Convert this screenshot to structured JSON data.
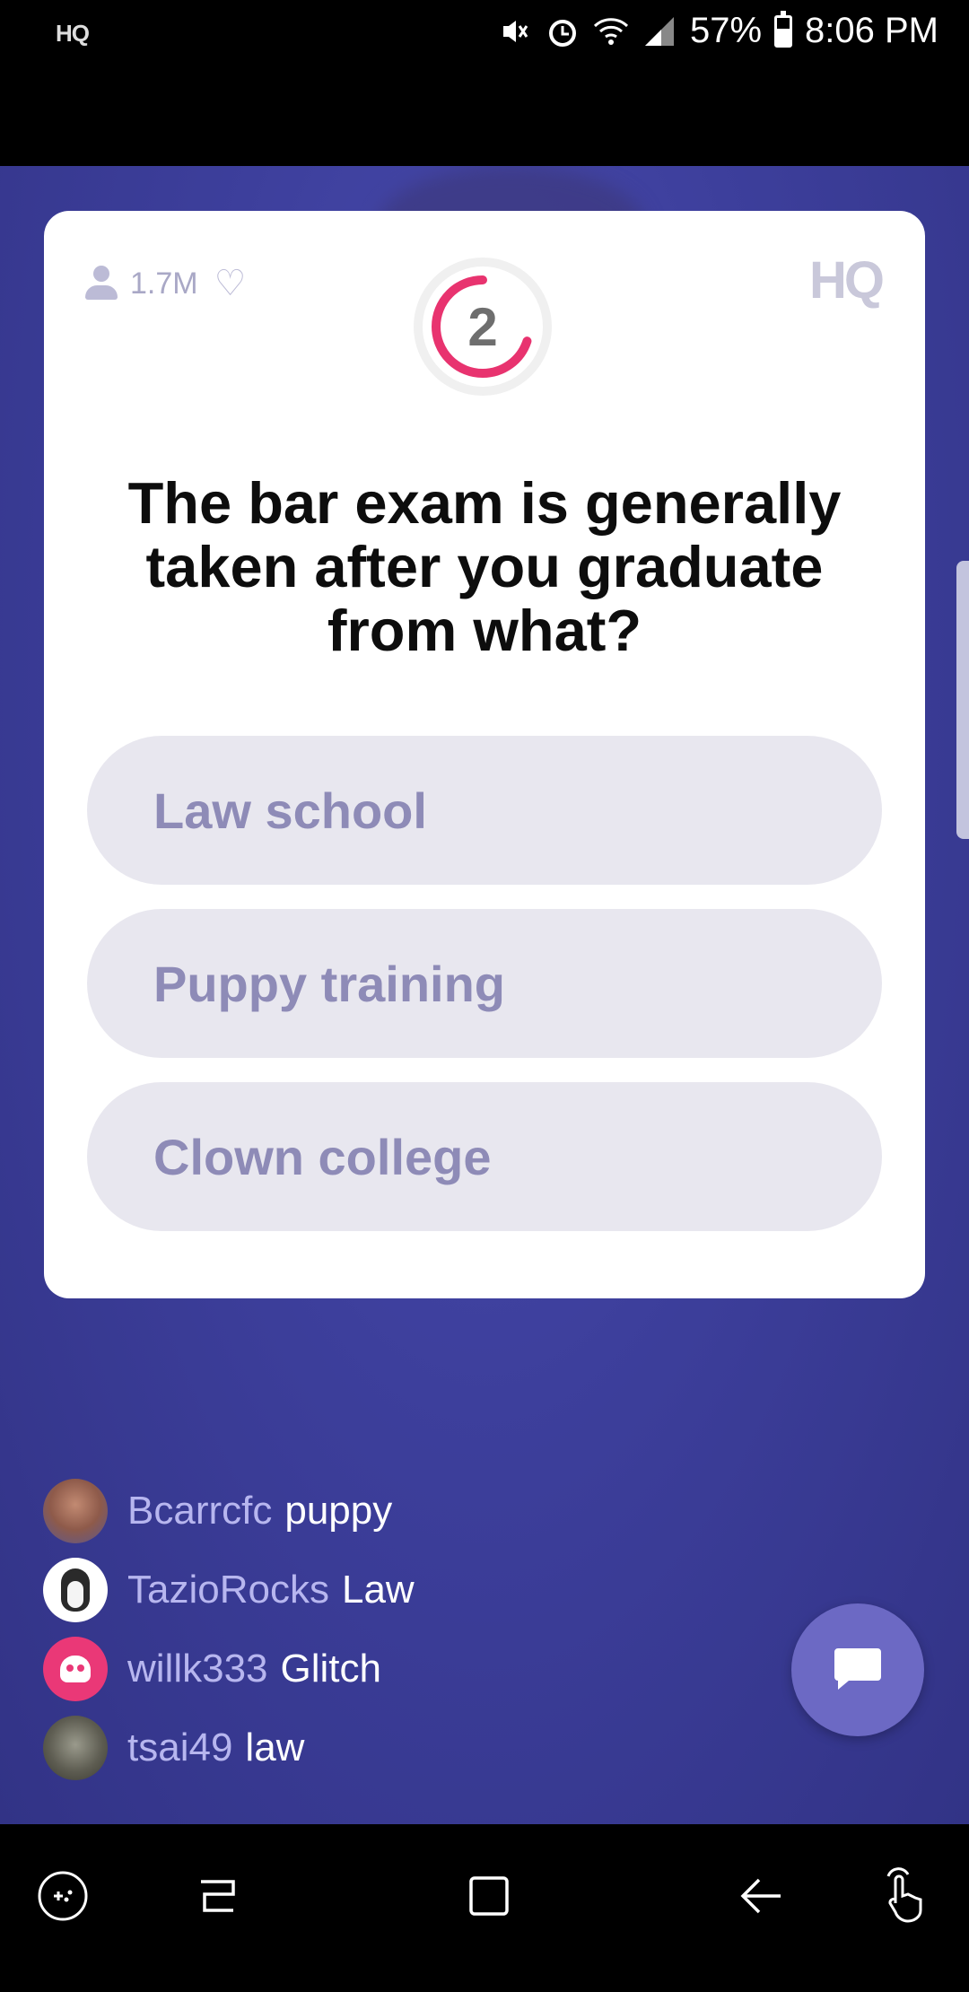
{
  "status_bar": {
    "app_label": "HQ",
    "battery": "57%",
    "time": "8:06 PM",
    "icons": [
      "mute-icon",
      "alarm-icon",
      "wifi-icon",
      "signal-icon",
      "battery-icon"
    ]
  },
  "card": {
    "viewers": "1.7M",
    "logo": "HQ",
    "timer": "2",
    "timer_progress": 0.7,
    "question": "The bar exam is generally taken after you graduate from what?",
    "answers": [
      "Law school",
      "Puppy training",
      "Clown college"
    ]
  },
  "chat": [
    {
      "user": "Bcarrcfc",
      "message": "puppy"
    },
    {
      "user": "TazioRocks",
      "message": "Law"
    },
    {
      "user": "willk333",
      "message": "Glitch"
    },
    {
      "user": "tsai49",
      "message": "law"
    }
  ],
  "colors": {
    "background": "#3d3f9c",
    "timer_ring": "#e8336f",
    "answer_bg": "#e8e7ef",
    "answer_text": "#8e8bb7",
    "chat_button": "#6c69c4"
  },
  "nav": [
    "game-launcher-icon",
    "recent-apps-icon",
    "home-icon",
    "back-icon",
    "gesture-icon"
  ]
}
